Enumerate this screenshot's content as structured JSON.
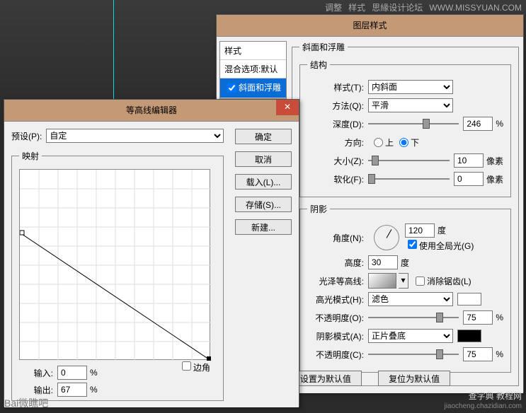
{
  "top_tabs": {
    "adjust": "调整",
    "styles": "样式"
  },
  "watermarks": {
    "forum": "思緣设计论坛",
    "forum_url": "WWW.MISSYUAN.COM",
    "bl": "Bai微瞧吧",
    "br_title": "查字典  教程网",
    "br_sub": "jiaocheng.chazidian.com"
  },
  "layer_style": {
    "title": "图层样式",
    "style_list_header": "样式",
    "blend_defaults": "混合选项:默认",
    "bevel_emboss": "斜面和浮雕",
    "group_bevel": "斜面和浮雕",
    "group_struct": "结构",
    "style_label": "样式(T):",
    "style_value": "内斜面",
    "method_label": "方法(Q):",
    "method_value": "平滑",
    "depth_label": "深度(D):",
    "depth_value": "246",
    "pct": "%",
    "direction_label": "方向:",
    "up": "上",
    "down": "下",
    "size_label": "大小(Z):",
    "size_value": "10",
    "px": "像素",
    "soften_label": "软化(F):",
    "soften_value": "0",
    "group_shade": "阴影",
    "angle_label": "角度(N):",
    "angle_value": "120",
    "deg": "度",
    "global_light": "使用全局光(G)",
    "altitude_label": "高度:",
    "altitude_value": "30",
    "gloss_label": "光泽等高线:",
    "antialias": "消除锯齿(L)",
    "hl_mode_label": "高光模式(H):",
    "hl_mode_value": "滤色",
    "hl_color": "#ffffff",
    "hl_opacity_label": "不透明度(O):",
    "hl_opacity_value": "75",
    "sh_mode_label": "阴影模式(A):",
    "sh_mode_value": "正片叠底",
    "sh_color": "#000000",
    "sh_opacity_label": "不透明度(C):",
    "sh_opacity_value": "75",
    "set_default": "设置为默认值",
    "reset_default": "复位为默认值"
  },
  "contour": {
    "title": "等高线编辑器",
    "preset_label": "预设(P):",
    "preset_value": "自定",
    "ok": "确定",
    "cancel": "取消",
    "load": "载入(L)...",
    "save": "存储(S)...",
    "new": "新建...",
    "mapping": "映射",
    "input_label": "输入:",
    "input_value": "0",
    "output_label": "输出:",
    "output_value": "67",
    "pct": "%",
    "corner": "边角"
  },
  "chart_data": {
    "type": "line",
    "title": "映射",
    "xlabel": "输入",
    "ylabel": "输出",
    "xlim": [
      0,
      100
    ],
    "ylim": [
      0,
      100
    ],
    "x": [
      0,
      100
    ],
    "values": [
      67,
      0
    ]
  }
}
